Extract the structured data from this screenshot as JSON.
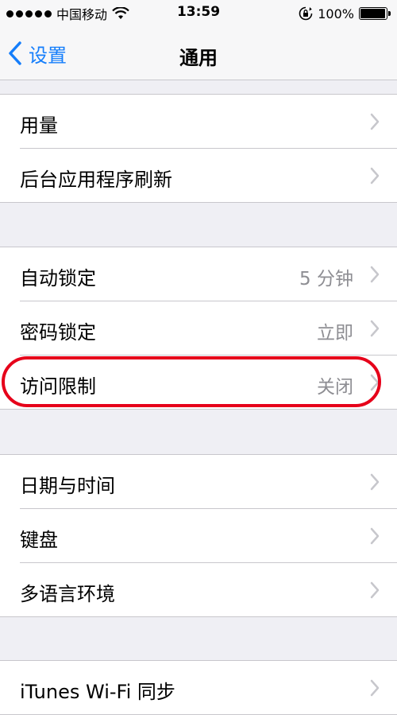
{
  "status_bar": {
    "carrier": "中国移动",
    "time": "13:59",
    "battery_percent": "100%"
  },
  "nav": {
    "back_label": "设置",
    "title": "通用"
  },
  "groups": [
    {
      "rows": [
        {
          "label": "用量",
          "value": ""
        },
        {
          "label": "后台应用程序刷新",
          "value": ""
        }
      ]
    },
    {
      "rows": [
        {
          "label": "自动锁定",
          "value": "5 分钟"
        },
        {
          "label": "密码锁定",
          "value": "立即"
        },
        {
          "label": "访问限制",
          "value": "关闭"
        }
      ]
    },
    {
      "rows": [
        {
          "label": "日期与时间",
          "value": ""
        },
        {
          "label": "键盘",
          "value": ""
        },
        {
          "label": "多语言环境",
          "value": ""
        }
      ]
    },
    {
      "rows": [
        {
          "label": "iTunes Wi-Fi 同步",
          "value": ""
        }
      ]
    }
  ],
  "colors": {
    "accent": "#157efb",
    "highlight": "#e6001a",
    "background": "#efeff4",
    "secondary_text": "#8e8e93"
  }
}
